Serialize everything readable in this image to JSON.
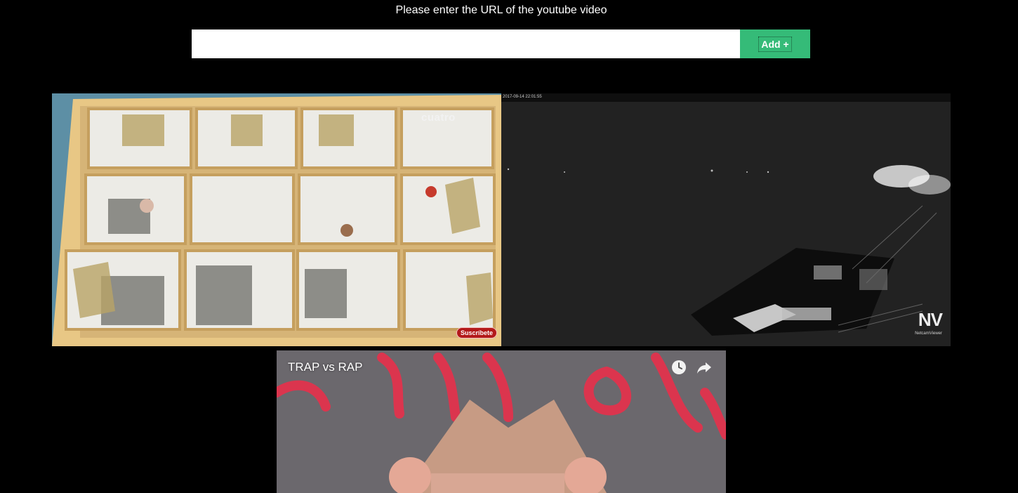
{
  "header": {
    "prompt": "Please enter the URL of the youtube video"
  },
  "url_form": {
    "input_value": "",
    "input_placeholder": "",
    "add_label": "Add +",
    "add_color": "#35bb78"
  },
  "videos": [
    {
      "channel_logo": "cuatro",
      "subscribe_badge": "Suscríbete",
      "icon": "rooms-top-view"
    },
    {
      "timestamp": "2017-09-14 22:01:55",
      "logo": "NV",
      "logo_sub": "NetcamViewer",
      "icon": "night-harbor-cam"
    },
    {
      "title": "TRAP vs RAP",
      "controls": [
        "clock-icon",
        "share-icon"
      ]
    }
  ],
  "colors": {
    "background": "#000000",
    "accent": "#35bb78"
  }
}
